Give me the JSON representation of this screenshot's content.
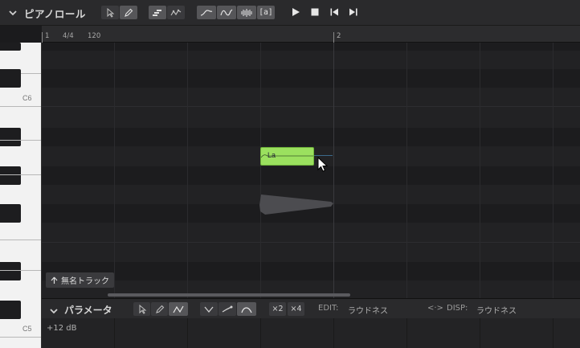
{
  "toolbar": {
    "title": "ピアノロール",
    "tools": [
      "select-tool",
      "pencil-tool"
    ],
    "modes": [
      "note-mode",
      "pitch-mode"
    ],
    "view_toggles": [
      "pitch-curve",
      "vibrato",
      "waveform",
      "phoneme-label"
    ],
    "phoneme_label_text": "[a]",
    "transport": [
      "play",
      "stop",
      "rewind",
      "forward"
    ]
  },
  "ruler": {
    "bar1": "1",
    "time_signature": "4/4",
    "tempo": "120",
    "bar2": "2"
  },
  "keyboard": {
    "c6": "C6",
    "c5": "C5"
  },
  "note": {
    "lyric": "La"
  },
  "track": {
    "name": "無名トラック"
  },
  "param": {
    "title": "パラメータ",
    "x2": "×2",
    "x4": "×4",
    "edit_label": "EDIT:",
    "edit_value": "ラウドネス",
    "disp_label": "DISP:",
    "disp_value": "ラウドネス",
    "disp_arrow": "<·>",
    "level": "+12 dB"
  },
  "colors": {
    "note_fill": "#9be05f",
    "accent": "#6fb33a",
    "background": "#222224"
  }
}
